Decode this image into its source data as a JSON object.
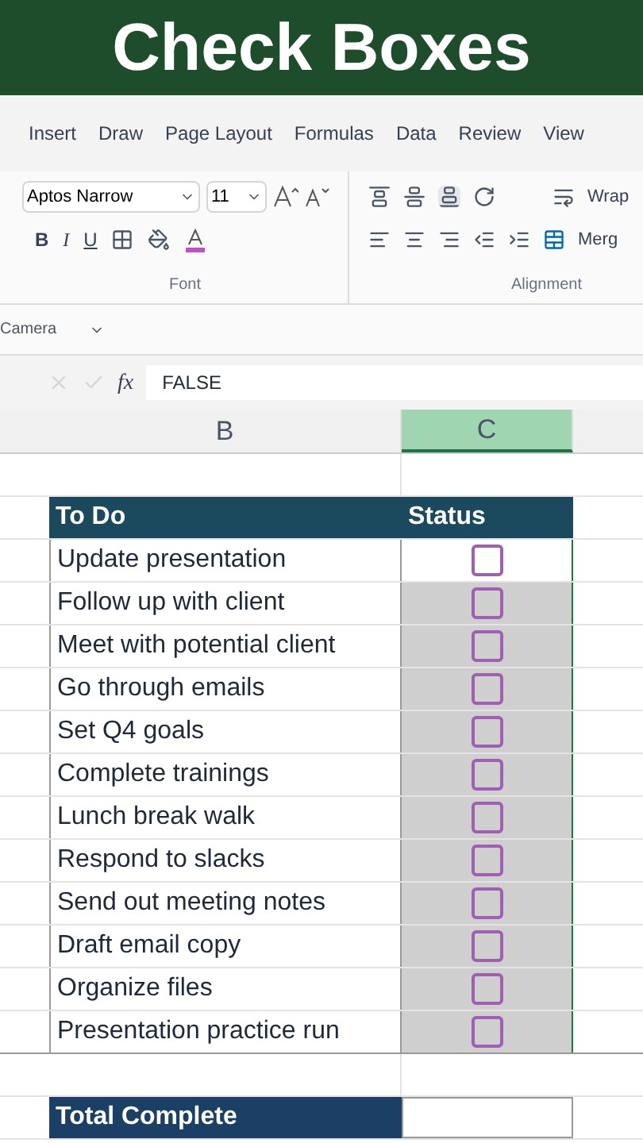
{
  "banner": {
    "title": "Check Boxes"
  },
  "ribbon_tabs": [
    "Insert",
    "Draw",
    "Page Layout",
    "Formulas",
    "Data",
    "Review",
    "View"
  ],
  "font_group": {
    "font_name": "Aptos Narrow",
    "font_size": "11",
    "bold": "B",
    "italic": "I",
    "underline": "U",
    "label": "Font"
  },
  "alignment_group": {
    "label": "Alignment",
    "wrap": "Wrap",
    "merge": "Merg"
  },
  "quick_access": {
    "label": "Camera"
  },
  "formula_bar": {
    "fx": "fx",
    "value": "FALSE"
  },
  "columns": [
    {
      "label": "B",
      "selected": false
    },
    {
      "label": "C",
      "selected": true
    }
  ],
  "table": {
    "headers": [
      "To Do",
      "Status"
    ],
    "rows": [
      {
        "task": "Update presentation",
        "checked": false,
        "highlighted": false
      },
      {
        "task": "Follow up with client",
        "checked": false,
        "highlighted": true
      },
      {
        "task": "Meet with potential client",
        "checked": false,
        "highlighted": true
      },
      {
        "task": "Go through emails",
        "checked": false,
        "highlighted": true
      },
      {
        "task": "Set Q4 goals",
        "checked": false,
        "highlighted": true
      },
      {
        "task": "Complete trainings",
        "checked": false,
        "highlighted": true
      },
      {
        "task": "Lunch break walk",
        "checked": false,
        "highlighted": true
      },
      {
        "task": "Respond to slacks",
        "checked": false,
        "highlighted": true
      },
      {
        "task": "Send out meeting notes",
        "checked": false,
        "highlighted": true
      },
      {
        "task": "Draft email copy",
        "checked": false,
        "highlighted": true
      },
      {
        "task": "Organize files",
        "checked": false,
        "highlighted": true
      },
      {
        "task": "Presentation practice run",
        "checked": false,
        "highlighted": true
      }
    ]
  },
  "total": {
    "label": "Total Complete"
  }
}
